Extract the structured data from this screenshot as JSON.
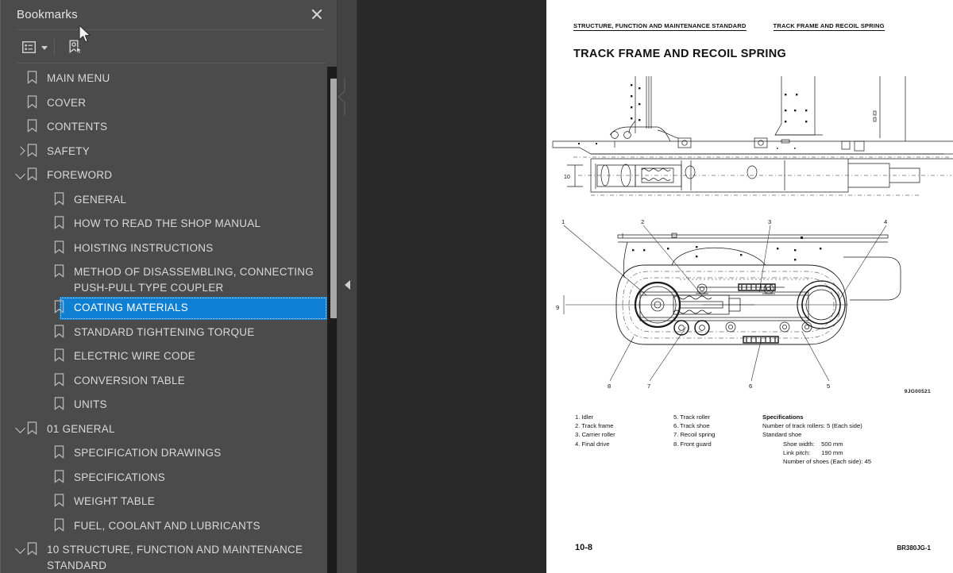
{
  "panel": {
    "title": "Bookmarks",
    "close_icon": "close-icon",
    "toolbar": {
      "options_icon": "list-options-icon",
      "options_caret_icon": "chevron-down-icon",
      "new_bookmark_icon": "new-bookmark-icon"
    }
  },
  "bookmarks": [
    {
      "label": "MAIN MENU",
      "level": 0,
      "twisty": "none"
    },
    {
      "label": "COVER",
      "level": 0,
      "twisty": "none"
    },
    {
      "label": "CONTENTS",
      "level": 0,
      "twisty": "none"
    },
    {
      "label": "SAFETY",
      "level": 0,
      "twisty": "closed"
    },
    {
      "label": "FOREWORD",
      "level": 0,
      "twisty": "open"
    },
    {
      "label": "GENERAL",
      "level": 1,
      "twisty": "none"
    },
    {
      "label": "HOW TO READ THE SHOP MANUAL",
      "level": 1,
      "twisty": "none"
    },
    {
      "label": "HOISTING INSTRUCTIONS",
      "level": 1,
      "twisty": "none"
    },
    {
      "label": "METHOD OF DISASSEMBLING, CONNECTING\nPUSH-PULL TYPE COUPLER",
      "level": 1,
      "twisty": "none"
    },
    {
      "label": "COATING MATERIALS",
      "level": 1,
      "twisty": "none",
      "selected": true
    },
    {
      "label": "STANDARD TIGHTENING TORQUE",
      "level": 1,
      "twisty": "none"
    },
    {
      "label": "ELECTRIC WIRE CODE",
      "level": 1,
      "twisty": "none"
    },
    {
      "label": "CONVERSION TABLE",
      "level": 1,
      "twisty": "none"
    },
    {
      "label": "UNITS",
      "level": 1,
      "twisty": "none"
    },
    {
      "label": "01  GENERAL",
      "level": 0,
      "twisty": "open"
    },
    {
      "label": "SPECIFICATION DRAWINGS",
      "level": 1,
      "twisty": "none"
    },
    {
      "label": "SPECIFICATIONS",
      "level": 1,
      "twisty": "none"
    },
    {
      "label": "WEIGHT TABLE",
      "level": 1,
      "twisty": "none"
    },
    {
      "label": "FUEL, COOLANT AND LUBRICANTS",
      "level": 1,
      "twisty": "none"
    },
    {
      "label": "10  STRUCTURE, FUNCTION AND MAINTENANCE\nSTANDARD",
      "level": 0,
      "twisty": "open"
    }
  ],
  "splitter": {
    "collapse_icon": "collapse-left-icon"
  },
  "document": {
    "header_left": "STRUCTURE, FUNCTION AND MAINTENANCE STANDARD",
    "header_right": "TRACK FRAME AND RECOIL SPRING",
    "title": "TRACK FRAME AND RECOIL SPRING",
    "figure_code": "9JG00521",
    "legend_left": [
      "1. Idler",
      "2. Track frame",
      "3. Carrier roller",
      "4. Final drive"
    ],
    "legend_right": [
      "5. Track roller",
      "6. Track shoe",
      "7. Recoil spring",
      "8. Front guard"
    ],
    "specifications": {
      "heading": "Specifications",
      "line1": "Number of track rollers: 5 (Each side)",
      "line2": "Standard shoe",
      "shoe_width_label": "Shoe width:",
      "shoe_width_value": "500 mm",
      "link_pitch_label": "Link pitch:",
      "link_pitch_value": "190 mm",
      "shoes_line": "Number of shoes (Each side):  45"
    },
    "callouts_bottom": [
      "1",
      "2",
      "3",
      "4",
      "5",
      "6",
      "7",
      "8",
      "9"
    ],
    "callout_top": "10",
    "footer_page": "10-8",
    "footer_code": "BR380JG-1"
  },
  "colors": {
    "panel_bg": "#4b4b4b",
    "selection_blue": "#0f7fd4",
    "viewer_bg": "#282828",
    "page_white": "#ffffff"
  }
}
